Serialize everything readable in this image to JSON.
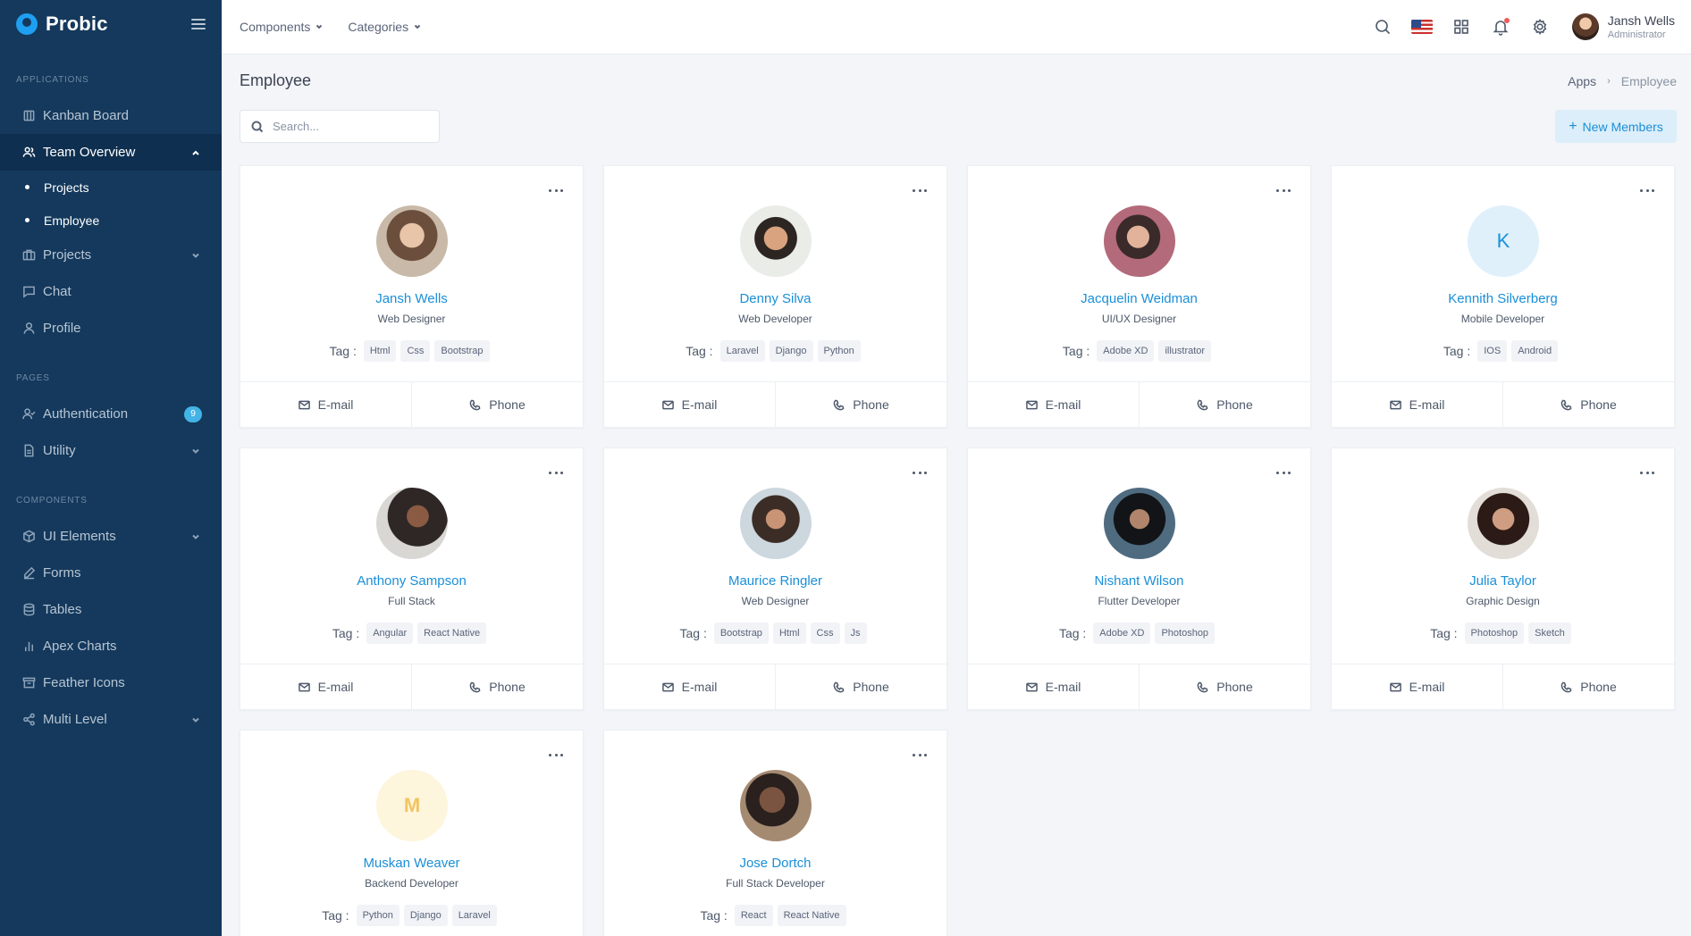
{
  "brand": {
    "name": "Probic"
  },
  "sidebar": {
    "sections": {
      "applications": "APPLICATIONS",
      "pages": "PAGES",
      "components": "COMPONENTS"
    },
    "items": {
      "kanban": "Kanban Board",
      "team_overview": "Team Overview",
      "projects_sub": "Projects",
      "employee_sub": "Employee",
      "projects": "Projects",
      "chat": "Chat",
      "profile": "Profile",
      "authentication": "Authentication",
      "authentication_badge": "9",
      "utility": "Utility",
      "ui_elements": "UI Elements",
      "forms": "Forms",
      "tables": "Tables",
      "apex_charts": "Apex Charts",
      "feather_icons": "Feather Icons",
      "multi_level": "Multi Level"
    }
  },
  "topbar": {
    "nav": {
      "components": "Components",
      "categories": "Categories"
    },
    "user": {
      "name": "Jansh Wells",
      "role": "Administrator"
    }
  },
  "page": {
    "title": "Employee",
    "breadcrumb": {
      "parent": "Apps",
      "current": "Employee"
    },
    "search_placeholder": "Search...",
    "new_button": "New Members",
    "new_button_icon": "+"
  },
  "card_labels": {
    "tag": "Tag :",
    "email": "E-mail",
    "phone": "Phone"
  },
  "employees": [
    {
      "name": "Jansh Wells",
      "role": "Web Designer",
      "tags": [
        "Html",
        "Css",
        "Bootstrap"
      ]
    },
    {
      "name": "Denny Silva",
      "role": "Web Developer",
      "tags": [
        "Laravel",
        "Django",
        "Python"
      ]
    },
    {
      "name": "Jacquelin Weidman",
      "role": "UI/UX Designer",
      "tags": [
        "Adobe XD",
        "illustrator"
      ]
    },
    {
      "name": "Kennith Silverberg",
      "role": "Mobile Developer",
      "tags": [
        "IOS",
        "Android"
      ],
      "initial": "K"
    },
    {
      "name": "Anthony Sampson",
      "role": "Full Stack",
      "tags": [
        "Angular",
        "React Native"
      ]
    },
    {
      "name": "Maurice Ringler",
      "role": "Web Designer",
      "tags": [
        "Bootstrap",
        "Html",
        "Css",
        "Js"
      ]
    },
    {
      "name": "Nishant Wilson",
      "role": "Flutter Developer",
      "tags": [
        "Adobe XD",
        "Photoshop"
      ]
    },
    {
      "name": "Julia Taylor",
      "role": "Graphic Design",
      "tags": [
        "Photoshop",
        "Sketch"
      ]
    },
    {
      "name": "Muskan Weaver",
      "role": "Backend Developer",
      "tags": [
        "Python",
        "Django",
        "Laravel"
      ],
      "initial": "M"
    },
    {
      "name": "Jose Dortch",
      "role": "Full Stack Developer",
      "tags": [
        "React",
        "React Native"
      ]
    }
  ]
}
